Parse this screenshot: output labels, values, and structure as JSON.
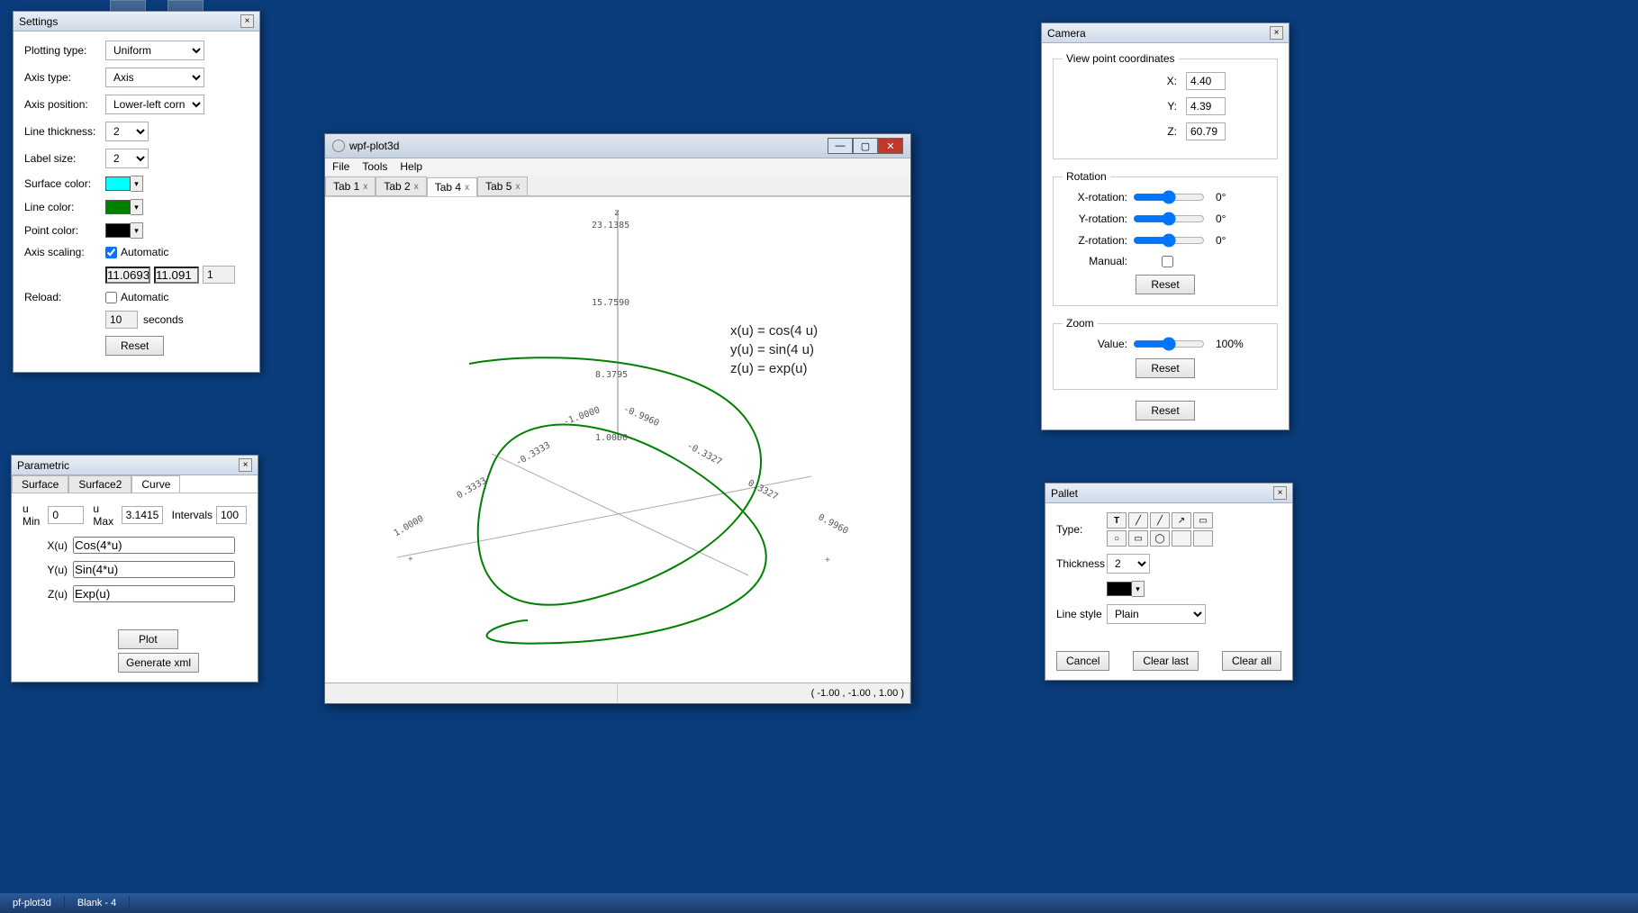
{
  "desktop": {
    "taskbar": [
      "pf-plot3d",
      "Blank - 4"
    ]
  },
  "settings": {
    "title": "Settings",
    "plotting_type_label": "Plotting type:",
    "plotting_type": "Uniform",
    "axis_type_label": "Axis type:",
    "axis_type": "Axis",
    "axis_pos_label": "Axis position:",
    "axis_pos": "Lower-left corner",
    "line_thick_label": "Line thickness:",
    "line_thick": "2",
    "label_size_label": "Label size:",
    "label_size": "2",
    "surface_color_label": "Surface color:",
    "surface_color": "#00ffff",
    "line_color_label": "Line color:",
    "line_color": "#008000",
    "point_color_label": "Point color:",
    "point_color": "#000000",
    "axis_scaling_label": "Axis scaling:",
    "axis_scaling_auto": "Automatic",
    "scale_x": "11.0693",
    "scale_y": "11.091",
    "scale_z": "1",
    "reload_label": "Reload:",
    "reload_auto": "Automatic",
    "reload_val": "10",
    "reload_unit": "seconds",
    "reset": "Reset"
  },
  "parametric": {
    "title": "Parametric",
    "tabs": [
      "Surface",
      "Surface2",
      "Curve"
    ],
    "active_tab": 2,
    "umin_label": "u Min",
    "umin": "0",
    "umax_label": "u Max",
    "umax": "3.1415",
    "intervals_label": "Intervals",
    "intervals": "100",
    "xu_label": "X(u)",
    "xu": "Cos(4*u)",
    "yu_label": "Y(u)",
    "yu": "Sin(4*u)",
    "zu_label": "Z(u)",
    "zu": "Exp(u)",
    "plot": "Plot",
    "genxml": "Generate xml"
  },
  "main": {
    "title": "wpf-plot3d",
    "menus": [
      "File",
      "Tools",
      "Help"
    ],
    "tabs": [
      "Tab 1",
      "Tab 2",
      "Tab 4",
      "Tab 5"
    ],
    "active_tab": 2,
    "equations": [
      "x(u) = cos(4 u)",
      "y(u) = sin(4 u)",
      "z(u) = exp(u)"
    ],
    "axis_labels": {
      "z_top": "z",
      "z_vals": [
        "23.1385",
        "15.7590",
        "8.3795",
        "1.0000"
      ],
      "diag_vals": [
        "-1.0000",
        "-0.9960",
        "-0.3333",
        "-0.3327",
        "0.3333",
        "0.3327",
        "1.0000",
        "0.9960"
      ]
    },
    "status_coords": "( -1.00 , -1.00 , 1.00 )"
  },
  "camera": {
    "title": "Camera",
    "vpc_legend": "View point coordinates",
    "x_label": "X:",
    "x": "4.40",
    "y_label": "Y:",
    "y": "4.39",
    "z_label": "Z:",
    "z": "60.79",
    "rot_legend": "Rotation",
    "xr_label": "X-rotation:",
    "xr_val": "0°",
    "yr_label": "Y-rotation:",
    "yr_val": "0°",
    "zr_label": "Z-rotation:",
    "zr_val": "0°",
    "manual_label": "Manual:",
    "reset": "Reset",
    "zoom_legend": "Zoom",
    "zoom_label": "Value:",
    "zoom_val": "100%",
    "reset_all": "Reset"
  },
  "pallet": {
    "title": "Pallet",
    "type_label": "Type:",
    "type_icons": [
      "T",
      "/",
      "/",
      "↗",
      "□",
      "○",
      "▭",
      "◯",
      "□",
      "□"
    ],
    "thick_label": "Thickness",
    "thick": "2",
    "color": "#000000",
    "style_label": "Line style",
    "style": "Plain",
    "cancel": "Cancel",
    "clear_last": "Clear last",
    "clear_all": "Clear all"
  }
}
